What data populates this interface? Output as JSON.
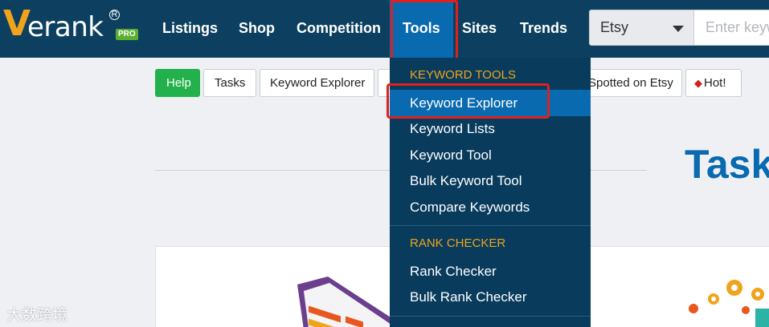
{
  "brand": {
    "logo_initial": "V",
    "logo_rest": "erank",
    "logo_registered": "R",
    "logo_badge": "PRO"
  },
  "nav": {
    "items": [
      "Listings",
      "Shop",
      "Competition",
      "Tools",
      "Sites",
      "Trends"
    ],
    "active": "Tools"
  },
  "search": {
    "platform": "Etsy",
    "placeholder": "Enter keyw"
  },
  "subnav": {
    "help": "Help",
    "tasks": "Tasks",
    "keyword_explorer": "Keyword Explorer",
    "spotted_on_etsy": "Spotted on Etsy",
    "hot": "Hot!"
  },
  "page": {
    "heading": "Task"
  },
  "tools_menu": {
    "sections": [
      {
        "title": "KEYWORD TOOLS",
        "items": [
          "Keyword Explorer",
          "Keyword Lists",
          "Keyword Tool",
          "Bulk Keyword Tool",
          "Compare Keywords"
        ]
      },
      {
        "title": "RANK CHECKER",
        "items": [
          "Rank Checker",
          "Bulk Rank Checker"
        ]
      }
    ],
    "active_item": "Keyword Explorer"
  },
  "watermark": {
    "text": "大数跨境"
  },
  "colors": {
    "nav_bg": "#0d4060",
    "accent": "#0a6ab0",
    "brand_orange": "#f0a41c",
    "help_green": "#22b14c",
    "highlight_red": "#e02020"
  }
}
